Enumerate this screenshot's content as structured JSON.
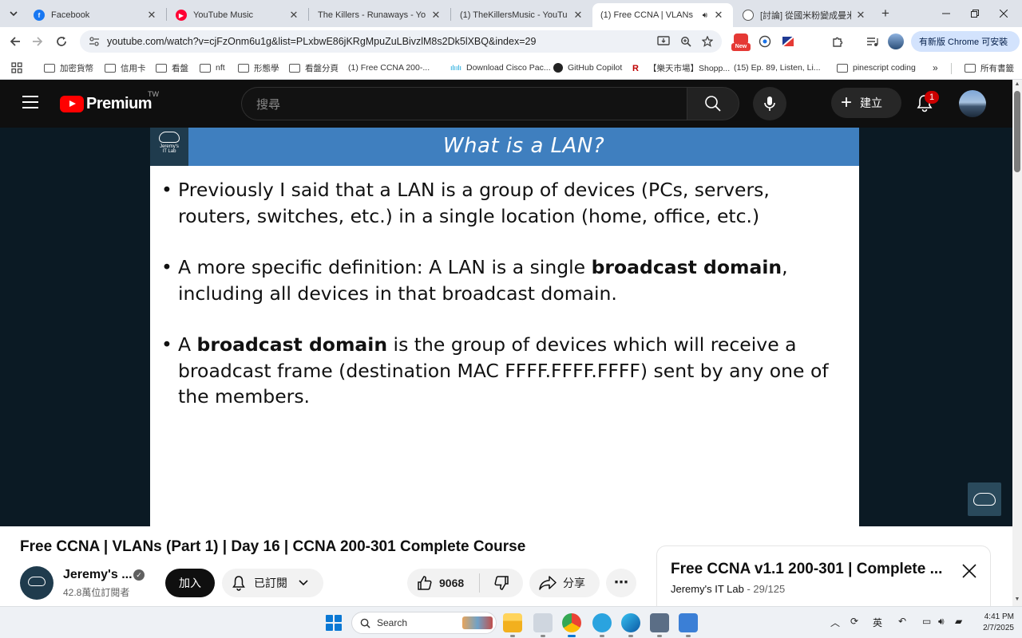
{
  "browser": {
    "tabs": [
      {
        "title": "Facebook",
        "favicon": "facebook-icon",
        "active": false
      },
      {
        "title": "YouTube Music",
        "favicon": "youtube-music-icon",
        "active": false
      },
      {
        "title": "The Killers - Runaways - Yo",
        "favicon": "youtube-icon",
        "active": false
      },
      {
        "title": "(1) TheKillersMusic - YouTu",
        "favicon": "youtube-icon",
        "active": false
      },
      {
        "title": "(1) Free CCNA | VLANs",
        "favicon": "youtube-icon",
        "active": true
      },
      {
        "title": "[討論] 從國米粉變成曼米粉",
        "favicon": "globe-icon",
        "active": false
      }
    ],
    "new_tab_label": "+",
    "url": "youtube.com/watch?v=cjFzOnm6u1g&list=PLxbwE86jKRgMpuZuLBivzlM8s2Dk5lXBQ&index=29",
    "update_button": "有新版 Chrome 可安裝",
    "new_badge": "New",
    "bookmarks": [
      {
        "label": "加密貨幣",
        "icon": "folder-icon"
      },
      {
        "label": "信用卡",
        "icon": "folder-icon"
      },
      {
        "label": "看盤",
        "icon": "folder-icon"
      },
      {
        "label": "nft",
        "icon": "folder-icon"
      },
      {
        "label": "形態學",
        "icon": "folder-icon"
      },
      {
        "label": "看盤分頁",
        "icon": "folder-icon"
      },
      {
        "label": "(1) Free CCNA 200-...",
        "icon": "youtube-icon"
      },
      {
        "label": "Download Cisco Pac...",
        "icon": "cisco-icon"
      },
      {
        "label": "GitHub Copilot",
        "icon": "github-icon"
      },
      {
        "label": "【樂天市場】Shopp...",
        "icon": "rakuten-icon"
      },
      {
        "label": "(15) Ep. 89, Listen, Li...",
        "icon": "youtube-icon"
      },
      {
        "label": "pinescript coding",
        "icon": "folder-icon"
      }
    ],
    "bookmarks_more": "»",
    "all_bookmarks": "所有書籤"
  },
  "youtube": {
    "logo_text": "Premium",
    "country_code": "TW",
    "search_placeholder": "搜尋",
    "create_label": "建立",
    "notification_count": "1",
    "slide": {
      "title": "What is a LAN?",
      "logo_line1": "Jeremy's",
      "logo_line2": "IT Lab",
      "bullet1": "Previously I said that a LAN is a group of devices (PCs, servers, routers, switches, etc.) in a single location (home, office, etc.)",
      "bullet2_a": "A more specific definition: A LAN is a single ",
      "bullet2_b": "broadcast domain",
      "bullet2_c": ", including all devices in that broadcast domain.",
      "bullet3_a": "A ",
      "bullet3_b": "broadcast domain",
      "bullet3_c": " is the group of devices which will receive a broadcast frame (destination MAC FFFF.FFFF.FFFF) sent by any one of the members."
    },
    "video_title": "Free CCNA | VLANs (Part 1) | Day 16 | CCNA 200-301 Complete Course",
    "channel": {
      "name": "Jeremy's ...",
      "subscribers": "42.8萬位訂閱者",
      "avatar_line1": "JEREMY'S",
      "avatar_line2": "IT LAB"
    },
    "join_label": "加入",
    "subscribed_label": "已訂閱",
    "like_count": "9068",
    "share_label": "分享",
    "more_label": "⋯",
    "playlist": {
      "title": "Free CCNA v1.1 200-301 | Complete ...",
      "owner": "Jeremy's IT Lab",
      "separator": " - ",
      "position": "29/125"
    }
  },
  "taskbar": {
    "search_label": "Search",
    "ime_label": "英",
    "time": "4:41 PM",
    "date": "2/7/2025"
  }
}
